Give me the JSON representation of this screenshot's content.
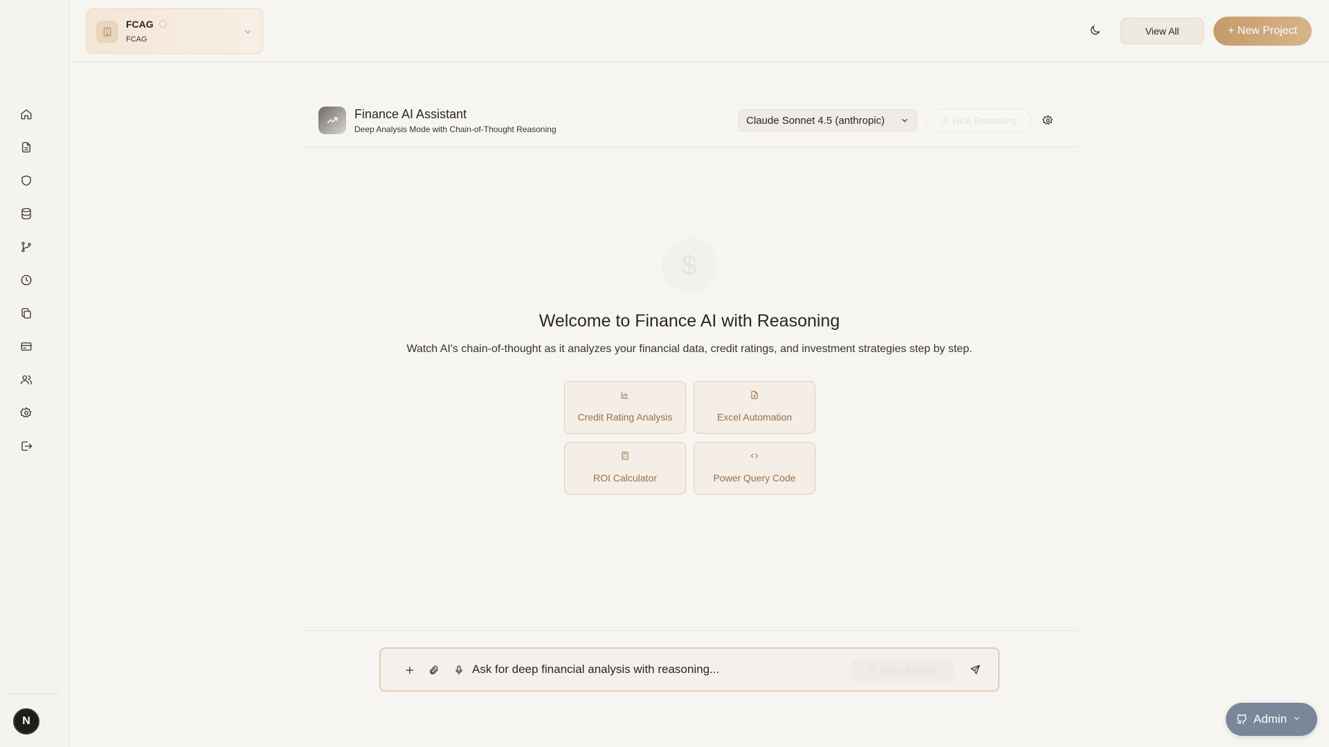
{
  "project": {
    "name": "FCAG",
    "subtitle": "FCAG"
  },
  "topbar": {
    "view_all_label": "View All",
    "new_project_label": "+ New Project"
  },
  "sidebar": {
    "items": [
      {
        "icon": "home-icon"
      },
      {
        "icon": "document-icon"
      },
      {
        "icon": "shield-icon"
      },
      {
        "icon": "database-icon"
      },
      {
        "icon": "git-branch-icon"
      },
      {
        "icon": "clock-icon"
      },
      {
        "icon": "copy-icon"
      },
      {
        "icon": "credit-card-icon"
      },
      {
        "icon": "users-icon"
      },
      {
        "icon": "settings-icon"
      },
      {
        "icon": "logout-icon"
      }
    ],
    "avatar_initial": "N"
  },
  "chat": {
    "title": "Finance AI Assistant",
    "subtitle": "Deep Analysis Mode with Chain-of-Thought Reasoning",
    "model_selected": "Claude Sonnet 4.5 (anthropic)",
    "hide_reasoning_label": "Hide Reasoning"
  },
  "welcome": {
    "icon_glyph": "$",
    "title": "Welcome to Finance AI with Reasoning",
    "subtitle": "Watch AI's chain-of-thought as it analyzes your financial data, credit ratings, and investment strategies step by step."
  },
  "suggestions": [
    {
      "label": "Credit Rating Analysis",
      "icon": "bar-chart-icon"
    },
    {
      "label": "Excel Automation",
      "icon": "file-text-icon"
    },
    {
      "label": "ROI Calculator",
      "icon": "calculator-icon"
    },
    {
      "label": "Power Query Code",
      "icon": "code-icon"
    }
  ],
  "composer": {
    "placeholder": "Ask for deep financial analysis with reasoning...",
    "deep_analysis_label": "Deep Analysis"
  },
  "admin": {
    "label": "Admin"
  },
  "colors": {
    "accent": "#c69a6a",
    "suggestion_border": "#e4cdb3",
    "suggestion_text": "#9a6e47",
    "admin_bg": "#78879a"
  }
}
